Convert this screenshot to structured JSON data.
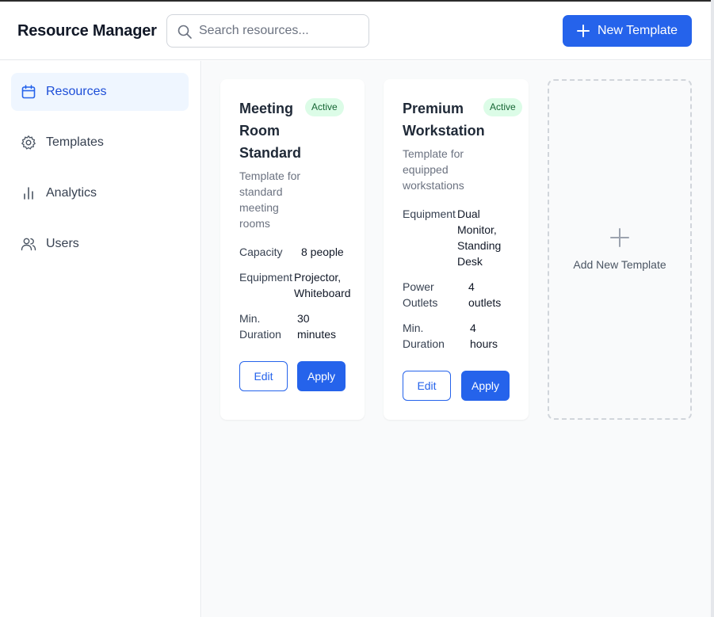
{
  "header": {
    "app_title": "Resource Manager",
    "search_placeholder": "Search resources...",
    "new_button_label": "New Template"
  },
  "sidebar": {
    "items": [
      {
        "label": "Resources",
        "icon": "calendar-icon",
        "active": true
      },
      {
        "label": "Templates",
        "icon": "gear-icon",
        "active": false
      },
      {
        "label": "Analytics",
        "icon": "bar-chart-icon",
        "active": false
      },
      {
        "label": "Users",
        "icon": "users-icon",
        "active": false
      }
    ]
  },
  "templates": [
    {
      "title_lines": [
        "Meeting",
        "Room",
        "Standard"
      ],
      "status": "Active",
      "desc_lines": [
        "Template for",
        "standard",
        "meeting",
        "rooms"
      ],
      "fields": [
        {
          "label_lines": [
            "Capacity"
          ],
          "value_lines": [
            "8 people"
          ]
        },
        {
          "label_lines": [
            "Equipment"
          ],
          "value_lines": [
            "Projector,",
            "Whiteboard"
          ]
        },
        {
          "label_lines": [
            "Min.",
            "Duration"
          ],
          "value_lines": [
            "30",
            "minutes"
          ]
        }
      ],
      "edit_label": "Edit",
      "apply_label": "Apply"
    },
    {
      "title_lines": [
        "Premium",
        "Workstation"
      ],
      "status": "Active",
      "desc_lines": [
        "Template for",
        "equipped",
        "workstations"
      ],
      "fields": [
        {
          "label_lines": [
            "Equipment"
          ],
          "value_lines": [
            "Dual",
            "Monitor,",
            "Standing",
            "Desk"
          ]
        },
        {
          "label_lines": [
            "Power",
            "Outlets"
          ],
          "value_lines": [
            "4",
            "outlets"
          ]
        },
        {
          "label_lines": [
            "Min.",
            "Duration"
          ],
          "value_lines": [
            "4",
            "hours"
          ]
        }
      ],
      "edit_label": "Edit",
      "apply_label": "Apply"
    }
  ],
  "add_card": {
    "label": "Add New Template"
  },
  "colors": {
    "accent": "#2563eb",
    "badge_bg": "#dcfce7",
    "badge_text": "#166534",
    "active_nav_bg": "#eff6ff"
  }
}
